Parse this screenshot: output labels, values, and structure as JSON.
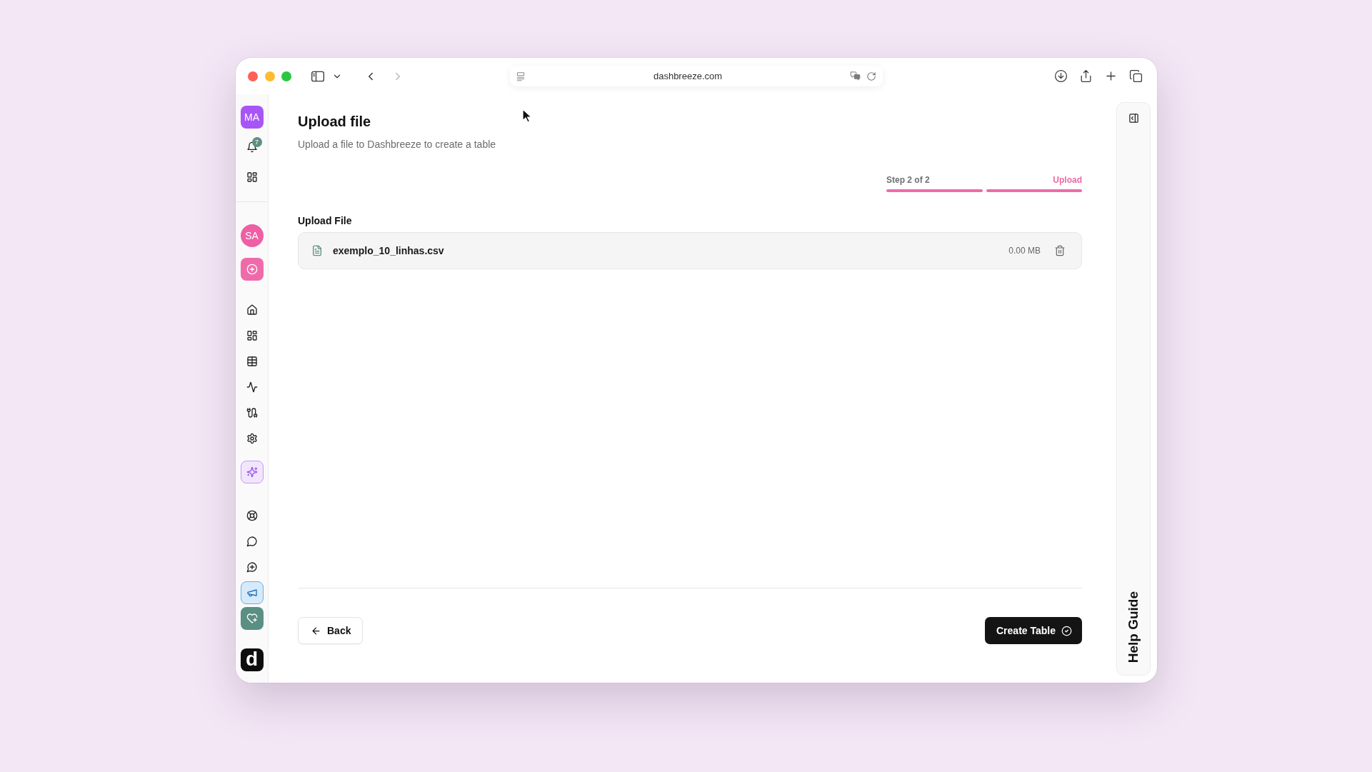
{
  "browser": {
    "url": "dashbreeze.com"
  },
  "sidebar": {
    "account": [
      {
        "kind": "user",
        "label": "MA"
      },
      {
        "kind": "notifications",
        "badge": "7"
      },
      {
        "kind": "apps"
      }
    ],
    "workspace": [
      {
        "kind": "org",
        "label": "SA"
      },
      {
        "kind": "create"
      }
    ],
    "nav": [
      {
        "kind": "home"
      },
      {
        "kind": "dashboards"
      },
      {
        "kind": "tables"
      },
      {
        "kind": "activity"
      },
      {
        "kind": "integrations"
      },
      {
        "kind": "settings"
      },
      {
        "kind": "ai"
      }
    ],
    "support": [
      {
        "kind": "help"
      },
      {
        "kind": "chat"
      },
      {
        "kind": "feedback"
      },
      {
        "kind": "announcements"
      },
      {
        "kind": "favorites"
      }
    ],
    "logo": {
      "label": "d"
    }
  },
  "page": {
    "title": "Upload file",
    "subtitle": "Upload a file to Dashbreeze to create a table"
  },
  "stepper": {
    "label": "Step 2 of 2",
    "current": "Upload",
    "steps": [
      {
        "complete": true
      },
      {
        "complete": true
      }
    ]
  },
  "upload": {
    "label": "Upload File",
    "file": {
      "name": "exemplo_10_linhas.csv",
      "size": "0.00 MB"
    }
  },
  "actions": [
    {
      "kind": "secondary",
      "label": "Back"
    },
    {
      "kind": "primary",
      "label": "Create Table"
    }
  ],
  "help_panel": {
    "title": "Help Guide"
  }
}
